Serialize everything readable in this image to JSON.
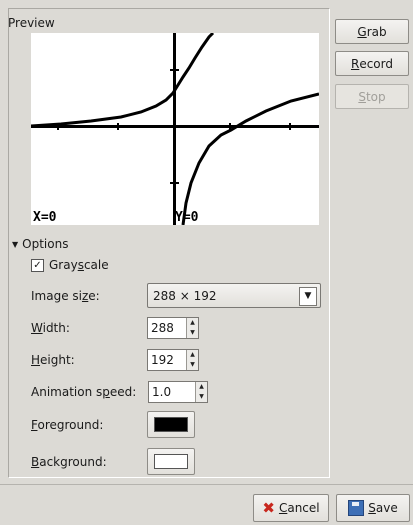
{
  "preview": {
    "title": "Preview",
    "x_readout": "X=0",
    "y_readout": "Y=0"
  },
  "side_buttons": {
    "grab": {
      "pre": "",
      "u": "G",
      "post": "rab"
    },
    "record": {
      "pre": "",
      "u": "R",
      "post": "ecord"
    },
    "stop": {
      "pre": "",
      "u": "S",
      "post": "top"
    }
  },
  "options": {
    "expander": "Options",
    "grayscale": {
      "pre": "Gray",
      "u": "s",
      "post": "cale",
      "checked": true
    },
    "image_size": {
      "pre": "Image si",
      "u": "z",
      "post": "e:",
      "value": "288 × 192"
    },
    "width": {
      "pre": "",
      "u": "W",
      "post": "idth:",
      "value": "288"
    },
    "height": {
      "pre": "",
      "u": "H",
      "post": "eight:",
      "value": "192"
    },
    "animation_speed": {
      "pre": "Animation s",
      "u": "p",
      "post": "eed:",
      "value": "1.0"
    },
    "foreground": {
      "pre": "",
      "u": "F",
      "post": "oreground:",
      "color": "#000000"
    },
    "background": {
      "pre": "",
      "u": "B",
      "post": "ackground:",
      "color": "#ffffff"
    }
  },
  "footer": {
    "cancel": {
      "pre": "",
      "u": "C",
      "post": "ancel"
    },
    "save": {
      "pre": "",
      "u": "S",
      "post": "ave"
    }
  }
}
